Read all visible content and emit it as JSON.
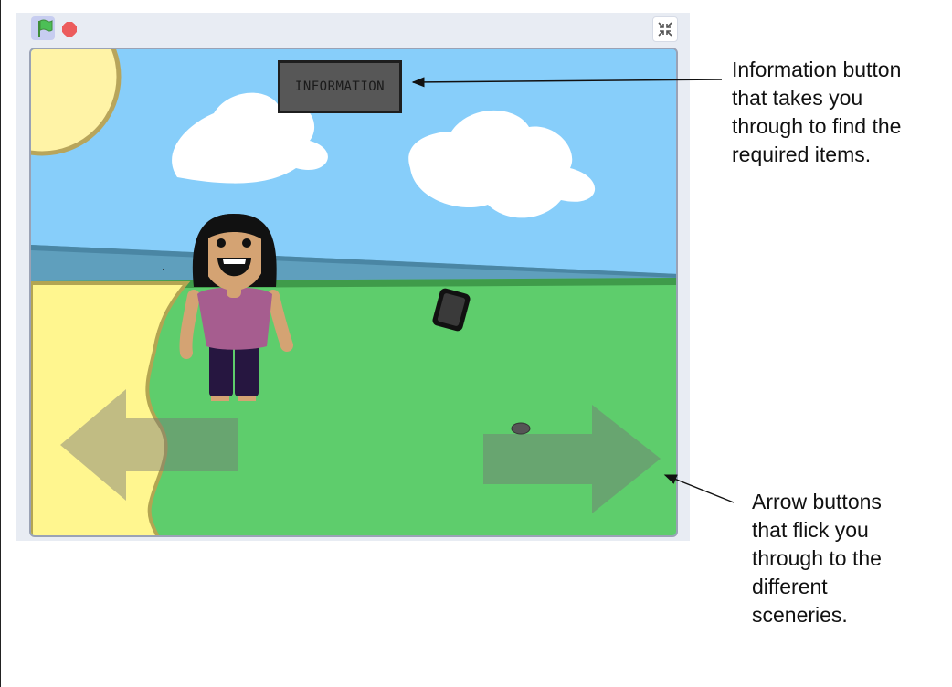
{
  "player": {
    "toolbar": {
      "green_flag_icon": "green-flag-icon",
      "stop_icon": "stop-icon",
      "fullscreen_icon": "shrink-fullscreen-icon"
    },
    "stage": {
      "info_button_label": "INFORMATION",
      "colors": {
        "sky": "#87cefa",
        "grass": "#5ecd6c",
        "sand": "#fff68f",
        "water": "#5f9fbd",
        "sun": "#fff3a6",
        "info_button": "#575757"
      }
    }
  },
  "annotations": {
    "info_note": "Information button that takes you through to find the required items.",
    "arrow_note": "Arrow buttons that flick you through to the different sceneries."
  }
}
